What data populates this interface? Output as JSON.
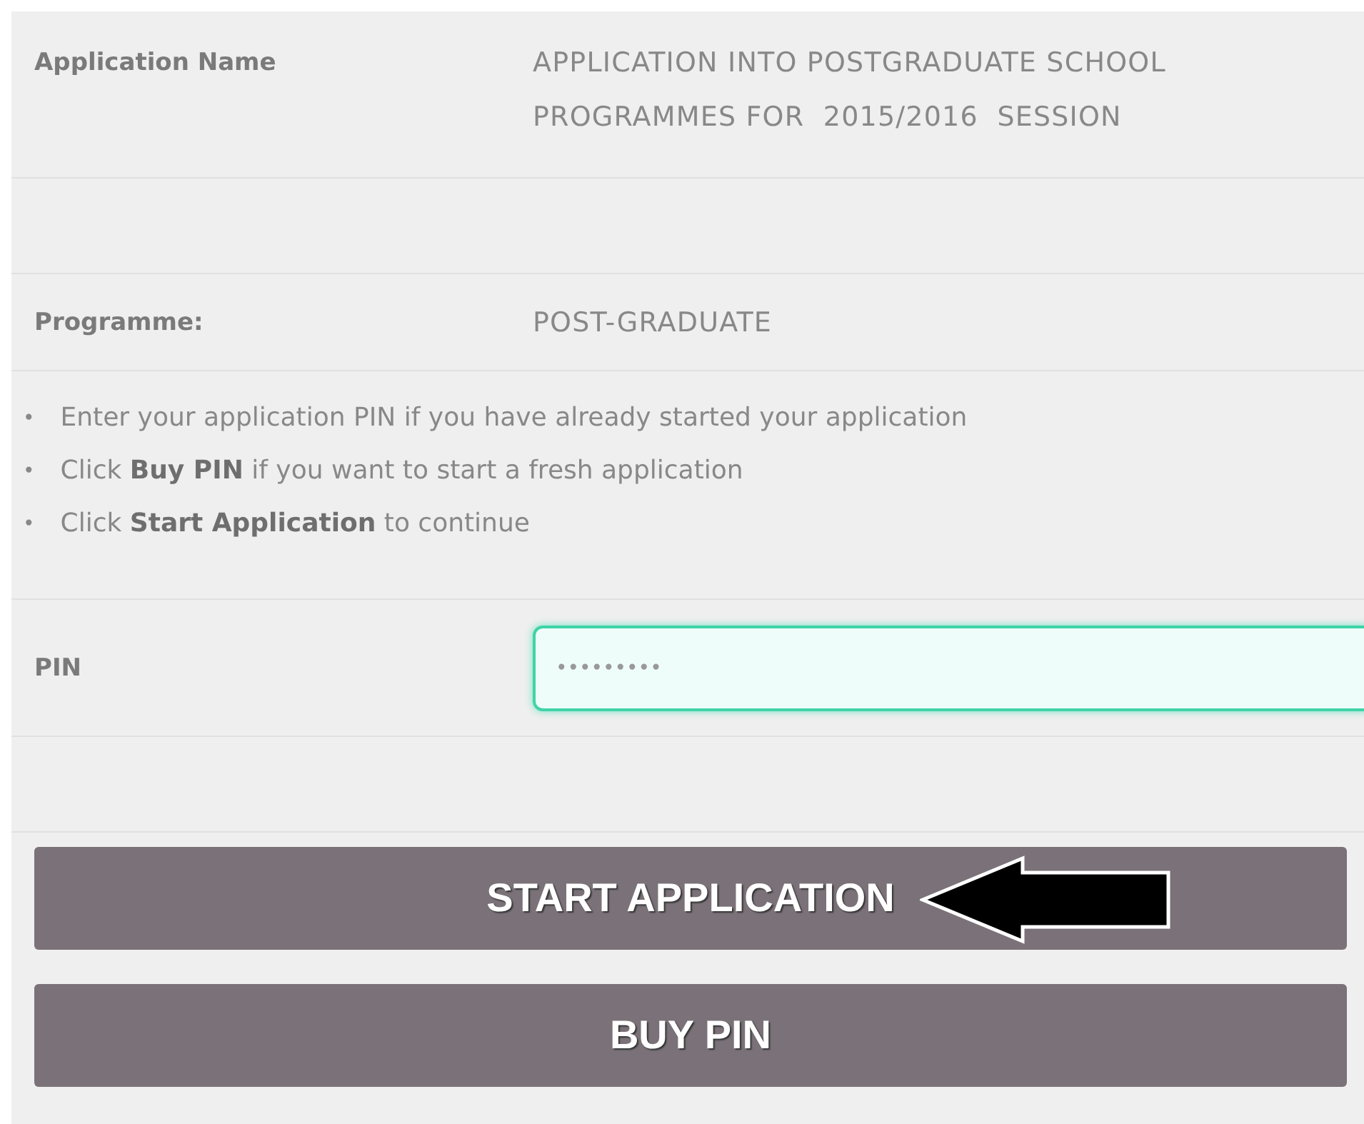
{
  "application_name": {
    "label": "Application Name",
    "lines": [
      "APPLICATION INTO POSTGRADUATE SCHOOL",
      "PROGRAMMES FOR  2015/2016  SESSION"
    ]
  },
  "programme": {
    "label": "Programme:",
    "value": "POST-GRADUATE"
  },
  "instructions": [
    {
      "bullet": "•",
      "text": "Enter your application PIN if you have already started your application"
    },
    {
      "bullet": "•",
      "text": "Click **Buy PIN** if you want to start a fresh application"
    },
    {
      "bullet": "•",
      "text": "Click **Start Application** to continue"
    }
  ],
  "pin": {
    "label": "PIN",
    "value": "•••••••••",
    "focused": true
  },
  "buttons": [
    {
      "label": "START APPLICATION",
      "pointer_arrow": true
    },
    {
      "label": "BUY PIN",
      "pointer_arrow": false
    }
  ]
}
